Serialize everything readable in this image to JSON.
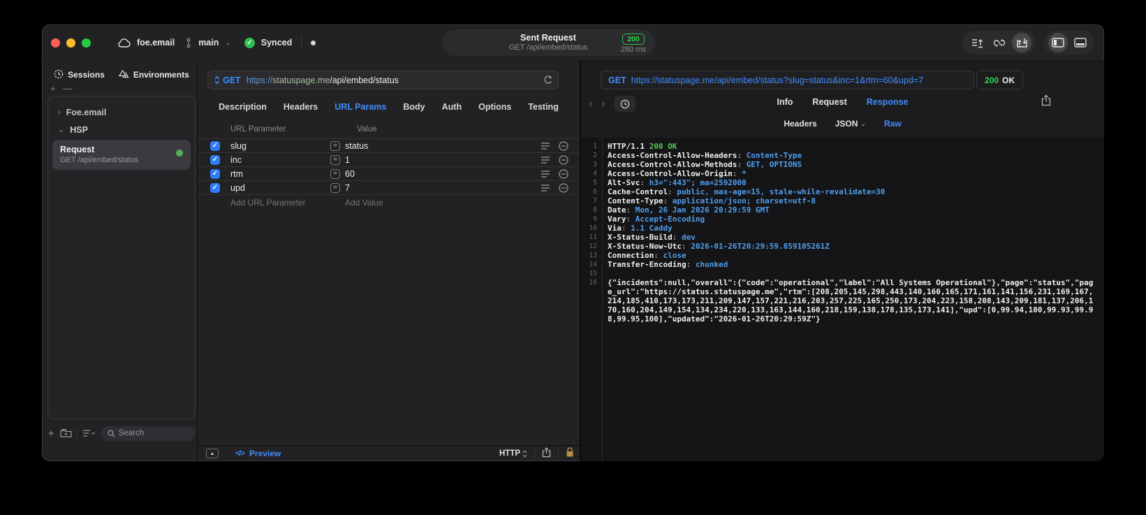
{
  "colors": {
    "accent_blue": "#3f8cff",
    "success_green": "#32d74b",
    "mono_value_blue": "#4f9ff0"
  },
  "window": {
    "project": "foe.email",
    "branch": "main",
    "sync_status": "Synced",
    "title": "Sent Request",
    "subtitle": "GET /api/embed/status",
    "status_code": "200",
    "duration": "280 ms"
  },
  "sidebar": {
    "tabs": [
      {
        "label": "Sessions"
      },
      {
        "label": "Environments"
      }
    ],
    "tree": [
      {
        "label": "Foe.email"
      },
      {
        "label": "HSP"
      }
    ],
    "request_item": {
      "title": "Request",
      "subtitle": "GET /api/embed/status"
    },
    "search_placeholder": "Search"
  },
  "editor": {
    "method": "GET",
    "url_scheme": "https://",
    "url_host": "statuspage.me",
    "url_path": "/api/embed/status",
    "tabs": [
      "Description",
      "Headers",
      "URL Params",
      "Body",
      "Auth",
      "Options",
      "Testing"
    ],
    "active_tab": "URL Params",
    "table": {
      "col_param": "URL Parameter",
      "col_value": "Value",
      "rows": [
        {
          "key": "slug",
          "value": "status",
          "checked": true
        },
        {
          "key": "inc",
          "value": "1",
          "checked": true
        },
        {
          "key": "rtm",
          "value": "60",
          "checked": true
        },
        {
          "key": "upd",
          "value": "7",
          "checked": true
        }
      ],
      "add_param": "Add URL Parameter",
      "add_value": "Add Value"
    },
    "footer": {
      "preview_label": "Preview",
      "code_glyph": "</>",
      "protocol": "HTTP"
    }
  },
  "response": {
    "method": "GET",
    "url": "https://statuspage.me/api/embed/status?slug=status&inc=1&rtm=60&upd=7",
    "status": "200",
    "status_text": "OK",
    "tabs": [
      "Info",
      "Request",
      "Response"
    ],
    "active_tab": "Response",
    "subtabs": [
      "Headers",
      "JSON",
      "Raw"
    ],
    "active_subtab": "Raw",
    "header_lines": [
      {
        "n": 1,
        "p": [
          [
            "w",
            "HTTP/1.1 "
          ],
          [
            "g",
            "200 OK"
          ]
        ]
      },
      {
        "n": 2,
        "p": [
          [
            "w",
            "Access-Control-Allow-Headers"
          ],
          [
            "d",
            ": "
          ],
          [
            "b",
            "Content-Type"
          ]
        ]
      },
      {
        "n": 3,
        "p": [
          [
            "w",
            "Access-Control-Allow-Methods"
          ],
          [
            "d",
            ": "
          ],
          [
            "b",
            "GET, OPTIONS"
          ]
        ]
      },
      {
        "n": 4,
        "p": [
          [
            "w",
            "Access-Control-Allow-Origin"
          ],
          [
            "d",
            ": "
          ],
          [
            "b",
            "*"
          ]
        ]
      },
      {
        "n": 5,
        "p": [
          [
            "w",
            "Alt-Svc"
          ],
          [
            "d",
            ": "
          ],
          [
            "b",
            "h3=\":443\"; ma=2592000"
          ]
        ]
      },
      {
        "n": 6,
        "p": [
          [
            "w",
            "Cache-Control"
          ],
          [
            "d",
            ": "
          ],
          [
            "b",
            "public, max-age=15, stale-while-revalidate=30"
          ]
        ]
      },
      {
        "n": 7,
        "p": [
          [
            "w",
            "Content-Type"
          ],
          [
            "d",
            ": "
          ],
          [
            "b",
            "application/json; charset=utf-8"
          ]
        ]
      },
      {
        "n": 8,
        "p": [
          [
            "w",
            "Date"
          ],
          [
            "d",
            ": "
          ],
          [
            "b",
            "Mon, 26 Jan 2026 20:29:59 GMT"
          ]
        ]
      },
      {
        "n": 9,
        "p": [
          [
            "w",
            "Vary"
          ],
          [
            "d",
            ": "
          ],
          [
            "b",
            "Accept-Encoding"
          ]
        ]
      },
      {
        "n": 10,
        "p": [
          [
            "w",
            "Via"
          ],
          [
            "d",
            ": "
          ],
          [
            "b",
            "1.1 Caddy"
          ]
        ]
      },
      {
        "n": 11,
        "p": [
          [
            "w",
            "X-Status-Build"
          ],
          [
            "d",
            ": "
          ],
          [
            "b",
            "dev"
          ]
        ]
      },
      {
        "n": 12,
        "p": [
          [
            "w",
            "X-Status-Now-Utc"
          ],
          [
            "d",
            ": "
          ],
          [
            "b",
            "2026-01-26T20:29:59.859105261Z"
          ]
        ]
      },
      {
        "n": 13,
        "p": [
          [
            "w",
            "Connection"
          ],
          [
            "d",
            ": "
          ],
          [
            "b",
            "close"
          ]
        ]
      },
      {
        "n": 14,
        "p": [
          [
            "w",
            "Transfer-Encoding"
          ],
          [
            "d",
            ": "
          ],
          [
            "b",
            "chunked"
          ]
        ]
      },
      {
        "n": 15,
        "p": []
      }
    ],
    "body_line_number": 16,
    "body": "{\"incidents\":null,\"overall\":{\"code\":\"operational\",\"label\":\"All Systems Operational\"},\"page\":\"status\",\"page_url\":\"https://status.statuspage.me\",\"rtm\":[208,205,145,298,443,140,160,165,171,161,141,156,231,169,167,214,185,410,173,173,211,209,147,157,221,216,203,257,225,165,250,173,204,223,158,208,143,209,181,137,206,170,160,204,149,154,134,234,220,133,163,144,160,218,159,138,178,135,173,141],\"upd\":[0,99.94,100,99.93,99.98,99.95,100],\"updated\":\"2026-01-26T20:29:59Z\"}"
  }
}
